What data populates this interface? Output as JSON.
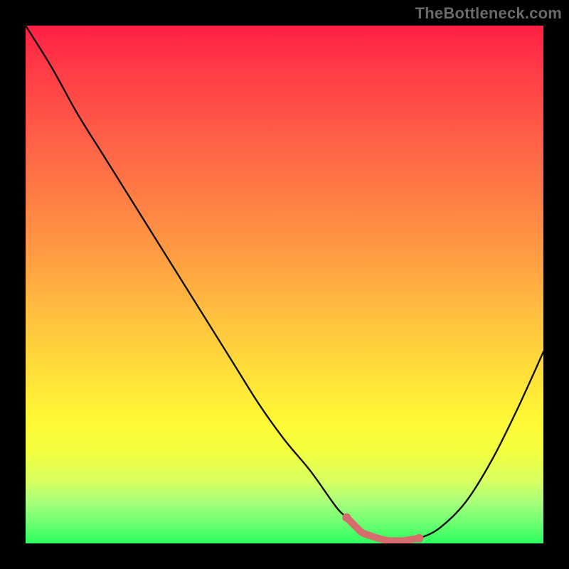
{
  "watermark": "TheBottleneck.com",
  "chart_data": {
    "type": "line",
    "title": "",
    "xlabel": "",
    "ylabel": "",
    "xlim": [
      0,
      100
    ],
    "ylim": [
      0,
      100
    ],
    "grid": false,
    "legend": false,
    "series": [
      {
        "name": "bottleneck-curve",
        "x": [
          0,
          5,
          10,
          15,
          20,
          25,
          30,
          35,
          40,
          45,
          50,
          55,
          60,
          62,
          65,
          68,
          70,
          73,
          76,
          80,
          85,
          90,
          95,
          100
        ],
        "y": [
          100,
          92,
          83,
          75,
          67,
          59,
          51,
          43,
          35,
          27,
          20,
          14,
          7,
          5,
          2,
          1,
          0.5,
          0.5,
          1,
          3,
          8,
          16,
          26,
          37
        ],
        "color": "#111111"
      }
    ],
    "highlight": {
      "name": "optimal-range",
      "x_start": 62,
      "x_end": 76,
      "color": "#d66d6d"
    },
    "background_gradient": {
      "stops": [
        {
          "pos": 0.0,
          "color": "#ff1f45"
        },
        {
          "pos": 0.2,
          "color": "#ff5a47"
        },
        {
          "pos": 0.44,
          "color": "#ff9b42"
        },
        {
          "pos": 0.66,
          "color": "#ffdc3a"
        },
        {
          "pos": 0.82,
          "color": "#f4ff3e"
        },
        {
          "pos": 0.92,
          "color": "#a8ff7a"
        },
        {
          "pos": 1.0,
          "color": "#2cff5e"
        }
      ]
    }
  }
}
